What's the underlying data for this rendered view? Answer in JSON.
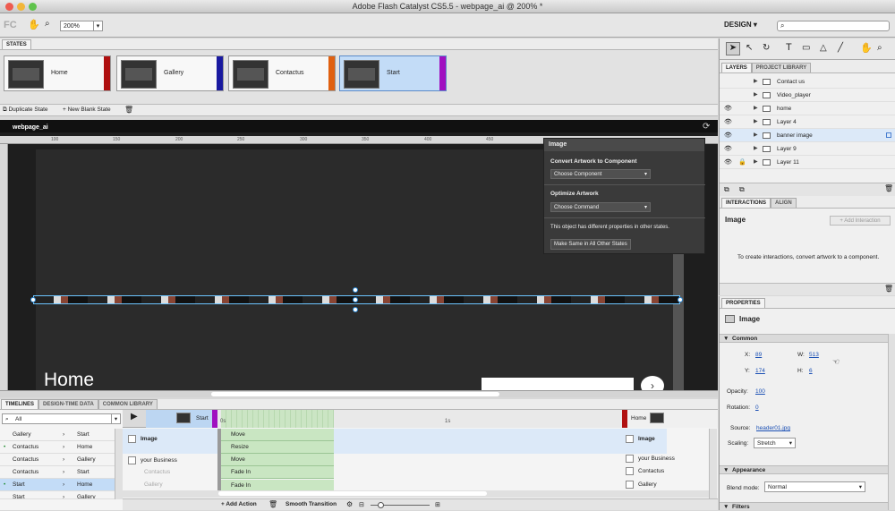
{
  "window": {
    "title": "Adobe Flash Catalyst CS5.5 - webpage_ai @ 200% *"
  },
  "toolbar": {
    "zoom": "200%",
    "workspace": "DESIGN",
    "logo": "FC"
  },
  "states_panel": {
    "tab": "STATES",
    "states": [
      {
        "label": "Home",
        "color": "#b01010"
      },
      {
        "label": "Gallery",
        "color": "#1a1aa0"
      },
      {
        "label": "Contactus",
        "color": "#e06010"
      },
      {
        "label": "Start",
        "color": "#a010c0"
      }
    ],
    "duplicate_label": "Duplicate State",
    "new_blank_label": "New Blank State"
  },
  "canvas": {
    "file_tab": "webpage_ai",
    "ruler_ticks": [
      "100",
      "150",
      "200",
      "250",
      "300",
      "350",
      "400",
      "450"
    ],
    "home_text": "Home"
  },
  "image_panel": {
    "title": "Image",
    "convert_heading": "Convert Artwork to Component",
    "component_placeholder": "Choose Component",
    "optimize_heading": "Optimize Artwork",
    "command_placeholder": "Choose Command",
    "notice": "This object has different properties in other states.",
    "make_same_label": "Make Same in All Other States"
  },
  "layers_panel": {
    "tabs": [
      "LAYERS",
      "PROJECT LIBRARY"
    ],
    "layers": [
      {
        "name": "Contact us",
        "eye": false,
        "lock": false
      },
      {
        "name": "Video_player",
        "eye": false,
        "lock": false
      },
      {
        "name": "home",
        "eye": true,
        "lock": false
      },
      {
        "name": "Layer 4",
        "eye": true,
        "lock": false
      },
      {
        "name": "banner image",
        "eye": true,
        "lock": false,
        "selected": true
      },
      {
        "name": "Layer 9",
        "eye": true,
        "lock": false
      },
      {
        "name": "Layer 11",
        "eye": true,
        "lock": true
      }
    ]
  },
  "interactions_panel": {
    "tabs": [
      "INTERACTIONS",
      "ALIGN"
    ],
    "object": "Image",
    "add_label": "+ Add Interaction",
    "hint": "To create interactions, convert artwork to a component."
  },
  "properties_panel": {
    "tab": "PROPERTIES",
    "object": "Image",
    "common_label": "Common",
    "x_label": "X:",
    "x": "89",
    "y_label": "Y:",
    "y": "174",
    "w_label": "W:",
    "w": "513",
    "h_label": "H:",
    "h": "6",
    "opacity_label": "Opacity:",
    "opacity": "100",
    "rotation_label": "Rotation:",
    "rotation": "0",
    "source_label": "Source:",
    "source": "header01.jpg",
    "scaling_label": "Scaling:",
    "scaling": "Stretch",
    "appearance_label": "Appearance",
    "blend_label": "Blend mode:",
    "blend": "Normal",
    "filters_label": "Filters"
  },
  "timelines": {
    "tabs": [
      "TIMELINES",
      "DESIGN-TIME DATA",
      "COMMON LIBRARY"
    ],
    "filter": "All",
    "transitions": [
      {
        "from": "Gallery",
        "to": "Start",
        "dot": false
      },
      {
        "from": "Contactus",
        "to": "Home",
        "dot": true
      },
      {
        "from": "Contactus",
        "to": "Gallery",
        "dot": false
      },
      {
        "from": "Contactus",
        "to": "Start",
        "dot": false
      },
      {
        "from": "Start",
        "to": "Home",
        "dot": true,
        "selected": true
      },
      {
        "from": "Start",
        "to": "Gallery",
        "dot": false
      }
    ],
    "from_state": "Start",
    "to_state": "Home",
    "time_start": "0s",
    "time_mid": "1s",
    "objects": [
      "Image",
      "your Business",
      "Contactus",
      "Gallery"
    ],
    "actions": [
      "Move",
      "Resize",
      "Move",
      "Fade In",
      "Fade In"
    ],
    "right_objects": [
      "Image",
      "your Business",
      "Contactus",
      "Gallery"
    ],
    "add_action_label": "+ Add Action",
    "smooth_label": "Smooth Transition"
  }
}
